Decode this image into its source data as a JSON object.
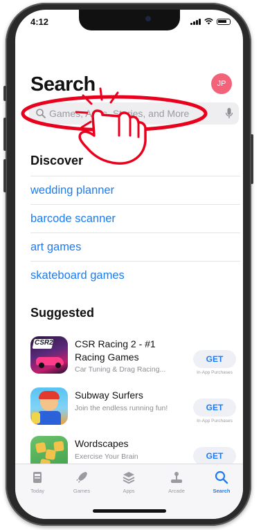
{
  "status": {
    "time": "4:12"
  },
  "header": {
    "title": "Search",
    "avatar_initials": "JP"
  },
  "search": {
    "placeholder": "Games, Apps, Stories, and More"
  },
  "discover": {
    "title": "Discover",
    "items": [
      "wedding planner",
      "barcode scanner",
      "art games",
      "skateboard games"
    ]
  },
  "suggested": {
    "title": "Suggested",
    "apps": [
      {
        "name": "CSR Racing 2 - #1 Racing Games",
        "subtitle": "Car Tuning & Drag Racing...",
        "action": "GET",
        "note": "In-App Purchases",
        "icon_text": "CSR2"
      },
      {
        "name": "Subway Surfers",
        "subtitle": "Join the endless running fun!",
        "action": "GET",
        "note": "In-App Purchases"
      },
      {
        "name": "Wordscapes",
        "subtitle": "Exercise Your Brain",
        "action": "GET",
        "note": ""
      }
    ]
  },
  "tabbar": {
    "tabs": [
      {
        "label": "Today",
        "icon": "today-icon"
      },
      {
        "label": "Games",
        "icon": "rocket-icon"
      },
      {
        "label": "Apps",
        "icon": "stack-icon"
      },
      {
        "label": "Arcade",
        "icon": "joystick-icon"
      },
      {
        "label": "Search",
        "icon": "search-icon",
        "active": true
      }
    ]
  },
  "colors": {
    "accent": "#1a7cf5",
    "avatar": "#f2637a",
    "annotation": "#e8001c"
  }
}
